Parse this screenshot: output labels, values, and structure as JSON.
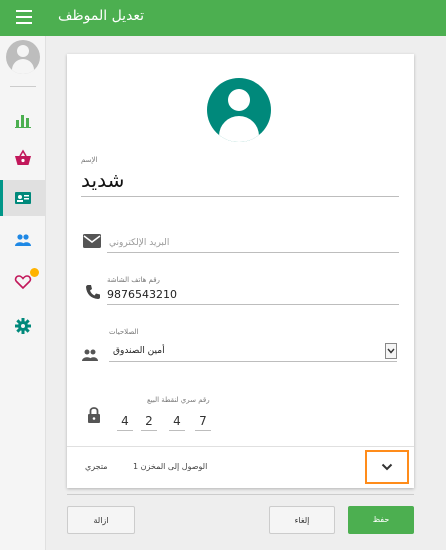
{
  "header": {
    "title": "تعديل الموظف",
    "menu_icon": "hamburger-menu-icon",
    "background": "#4caf50"
  },
  "sidebar": {
    "items": [
      {
        "name": "reports",
        "icon": "bar-chart-icon",
        "color": "#4caf50"
      },
      {
        "name": "sales",
        "icon": "shopping-basket-icon",
        "color": "#c2185b"
      },
      {
        "name": "employees",
        "icon": "id-card-icon",
        "color": "#00897b",
        "active": true
      },
      {
        "name": "customers",
        "icon": "people-icon",
        "color": "#1e88e5"
      },
      {
        "name": "loyalty",
        "icon": "heart-icon",
        "color": "#c2185b"
      },
      {
        "name": "settings",
        "icon": "gear-icon",
        "color": "#00897b"
      }
    ]
  },
  "form": {
    "name_label": "الإسم",
    "name_value": "شديد",
    "email_placeholder": "البريد الإلكتروني",
    "phone_label": "رقم هاتف الشاشة",
    "phone_value": "9876543210",
    "role_label": "الصلاحيات",
    "role_value": "أمين الصندوق",
    "pin_label": "رقم سري لنقطة البيع",
    "pin_digits": [
      "4",
      "2",
      "4",
      "7"
    ],
    "store_label": "متجري",
    "access_label": "الوصول إلى المخزن 1"
  },
  "footer": {
    "delete_label": "ازالة",
    "cancel_label": "إلغاء",
    "save_label": "حفظ"
  },
  "colors": {
    "primary": "#4caf50",
    "avatar": "#00897b",
    "highlight_border": "#ff8c1a"
  }
}
